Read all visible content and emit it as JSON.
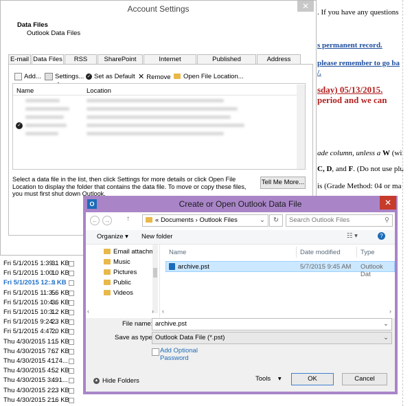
{
  "document": {
    "line1": ". If you have any questions",
    "line2": "s permanent record.",
    "line3": "please remember to go ba",
    "line4": "/.",
    "line5": "sday) 05/13/2015.",
    "line6": "period and we can",
    "line7_pre": "ade column, unless a ",
    "line7_bold": "W",
    "line7_post": " (wi",
    "line8_pre": "C, ",
    "line8_b2": "D",
    "line8_mid": ", and ",
    "line8_b3": "F",
    "line8_post": ".  (Do not use plu",
    "line9": "is (Grade Method: 04 or ma"
  },
  "mail_list": [
    {
      "date": "Fri 5/1/2015 1:39...",
      "size": "31 KB"
    },
    {
      "date": "Fri 5/1/2015 1:00...",
      "size": "10 KB"
    },
    {
      "date": "Fri 5/1/2015 12:...",
      "size": "9 KB"
    },
    {
      "date": "Fri 5/1/2015 11:3...",
      "size": "56 KB"
    },
    {
      "date": "Fri 5/1/2015 10:4...",
      "size": "36 KB"
    },
    {
      "date": "Fri 5/1/2015 10:3...",
      "size": "12 KB"
    },
    {
      "date": "Fri 5/1/2015 9:24...",
      "size": "23 KB"
    },
    {
      "date": "Fri 5/1/2015 4:47...",
      "size": "20 KB"
    },
    {
      "date": "Thu 4/30/2015 1:...",
      "size": "15 KB"
    },
    {
      "date": "Thu 4/30/2015 7:...",
      "size": "67 KB"
    },
    {
      "date": "Thu 4/30/2015 4:...",
      "size": "174..."
    },
    {
      "date": "Thu 4/30/2015 4:...",
      "size": "52 KB"
    },
    {
      "date": "Thu 4/30/2015 3:...",
      "size": "491..."
    },
    {
      "date": "Thu 4/30/2015 2:...",
      "size": "23 KB"
    },
    {
      "date": "Thu 4/30/2015 2:...",
      "size": "16 KB"
    }
  ],
  "account_settings": {
    "title": "Account Settings",
    "close": "✕",
    "heading": "Data Files",
    "subheading": "Outlook Data Files",
    "tabs": [
      "E-mail",
      "Data Files",
      "RSS Feeds",
      "SharePoint Lists",
      "Internet Calendars",
      "Published Calendars",
      "Address Books"
    ],
    "toolbar": {
      "add": "Add...",
      "settings": "Settings...",
      "default": "Set as Default",
      "remove": "Remove",
      "open_location": "Open File Location..."
    },
    "columns": {
      "name": "Name",
      "location": "Location"
    },
    "description": "Select a data file in the list, then click Settings for more details or click Open File Location to display the folder that contains the data file. To move or copy these files, you must first shut down Outlook.",
    "tell_me_more": "Tell Me More..."
  },
  "dialog": {
    "app_icon": "O",
    "title": "Create or Open Outlook Data File",
    "close": "✕",
    "path": {
      "prefix": "«",
      "part1": "Documents",
      "sep": "›",
      "part2": "Outlook Files"
    },
    "search_placeholder": "Search Outlook Files",
    "organize": "Organize ▾",
    "new_folder": "New folder",
    "nav_items": [
      "Email attachm",
      "Music",
      "Pictures",
      "Public",
      "Videos"
    ],
    "columns": {
      "name": "Name",
      "date": "Date modified",
      "type": "Type"
    },
    "files": [
      {
        "name": "archive.pst",
        "date": "5/7/2015 9:45 AM",
        "type": "Outlook Dat"
      }
    ],
    "file_name_label": "File name:",
    "file_name_value": "archive.pst",
    "save_type_label": "Save as type:",
    "save_type_value": "Outlook Data File (*.pst)",
    "add_optional_password": "Add Optional Password",
    "hide_folders": "Hide Folders",
    "tools": "Tools",
    "ok": "OK",
    "cancel": "Cancel"
  }
}
